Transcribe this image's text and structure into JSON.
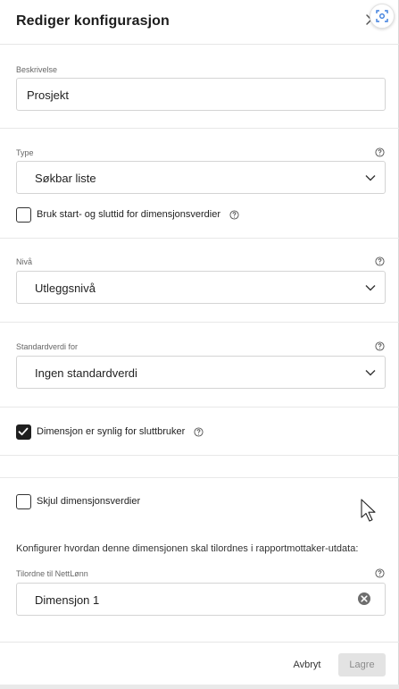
{
  "dialog": {
    "title": "Rediger konfigurasjon"
  },
  "description": {
    "label": "Beskrivelse",
    "value": "Prosjekt"
  },
  "type": {
    "label": "Type",
    "value": "Søkbar liste"
  },
  "start_end": {
    "label": "Bruk start- og sluttid for dimensjonsverdier",
    "checked": false
  },
  "level": {
    "label": "Nivå",
    "value": "Utleggsnivå"
  },
  "default": {
    "label": "Standardverdi for",
    "value": "Ingen standardverdi"
  },
  "visible": {
    "label": "Dimensjon er synlig for sluttbruker",
    "checked": true
  },
  "hide_values": {
    "label": "Skjul dimensjonsverdier",
    "checked": false
  },
  "mapping": {
    "info": "Konfigurer hvordan denne dimensjonen skal tilordnes i rapportmottaker-utdata:",
    "label": "Tilordne til NettLønn",
    "value": "Dimensjon 1"
  },
  "footer": {
    "cancel_label": "Avbryt",
    "save_label": "Lagre"
  },
  "icons": {
    "close": "close-icon",
    "help": "help-icon",
    "chevron": "chevron-down-icon",
    "check": "checkmark-icon",
    "clear": "clear-icon",
    "screen": "screenshot-icon"
  },
  "colors": {
    "accent": "#1f1f1f",
    "screen_icon": "#3b7ddd",
    "disabled_bg": "#e3e3e3"
  }
}
